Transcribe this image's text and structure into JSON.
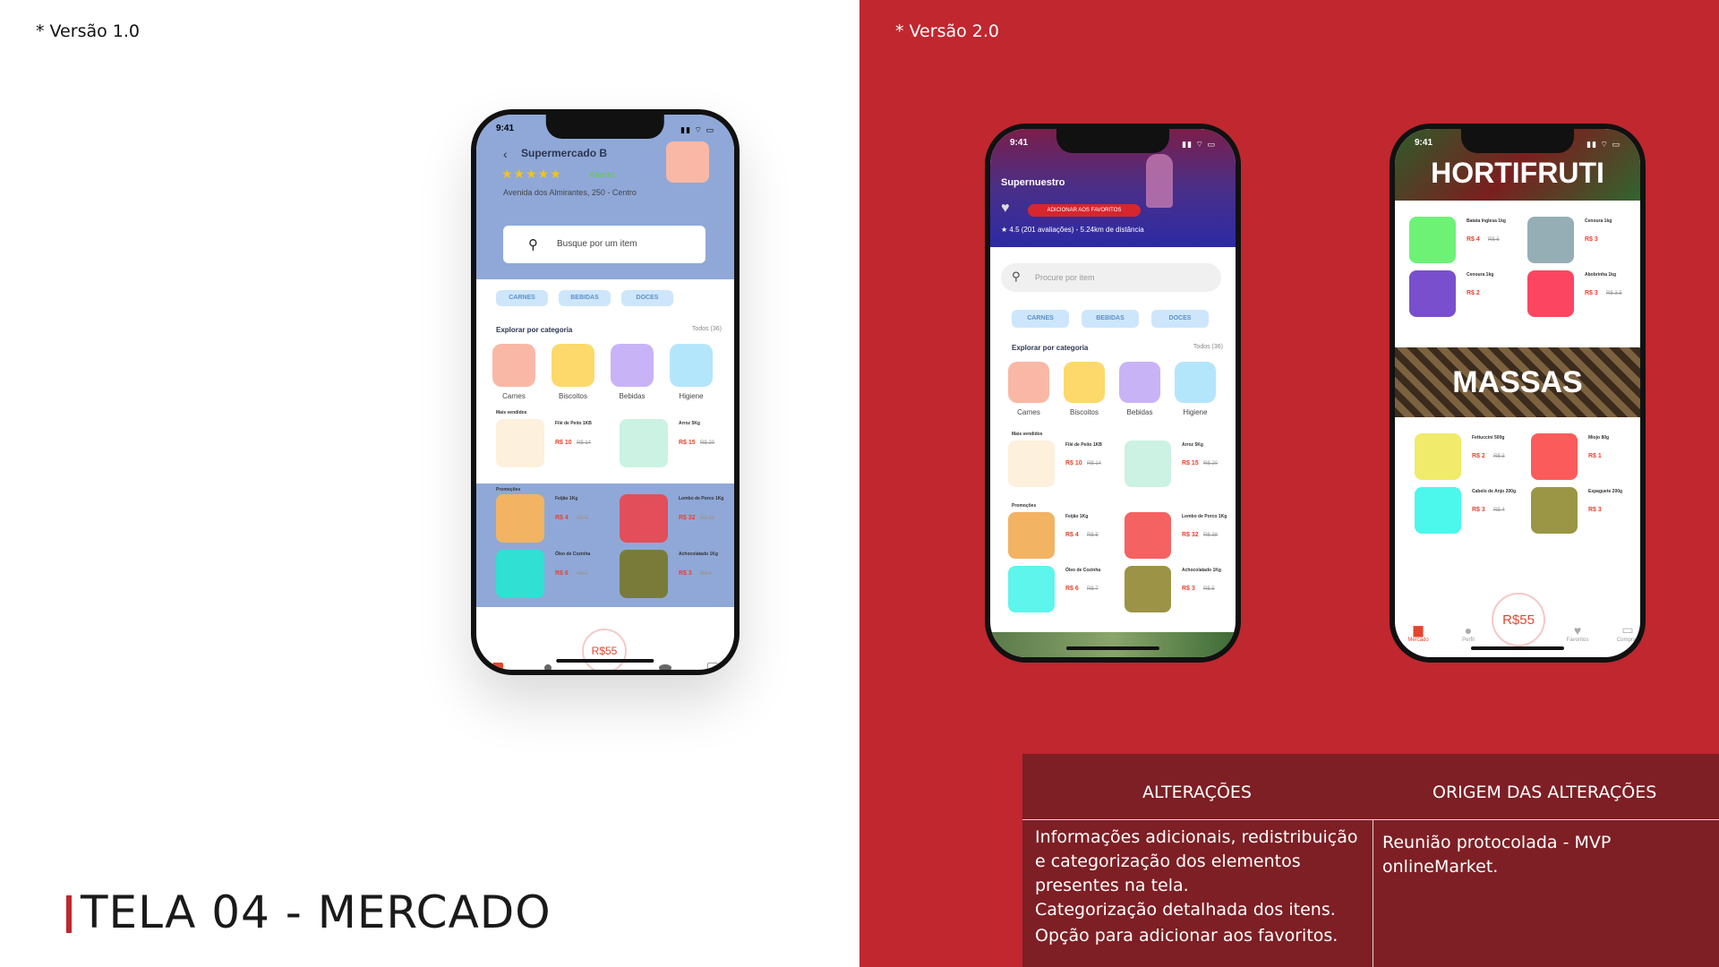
{
  "left": {
    "version_label": "* Versão 1.0",
    "slide_title": "TELA 04 - MERCADO"
  },
  "right": {
    "version_label": "* Versão 2.0"
  },
  "phone1": {
    "time": "9:41",
    "store_name": "Supermercado B",
    "rating_stars": "★★★★★",
    "open_status": "Aberto",
    "address": "Avenida dos Almirantes, 250 - Centro",
    "search_placeholder": "Busque por um item",
    "chips": [
      "CARNES",
      "BEBIDAS",
      "DOCES"
    ],
    "explore_title": "Explorar por categoria",
    "explore_all": "Todos (36)",
    "categories": [
      {
        "label": "Carnes",
        "color": "#f9b8a6"
      },
      {
        "label": "Biscoitos",
        "color": "#fcd96a"
      },
      {
        "label": "Bebidas",
        "color": "#c8b3f7"
      },
      {
        "label": "Higiene",
        "color": "#b4e6fb"
      }
    ],
    "best_sellers_title": "Mais vendidos",
    "best_sellers": [
      {
        "name": "Filé de Peito 1KB",
        "price": "R$ 10",
        "old": "R$ 14",
        "color": "#fdf0dc"
      },
      {
        "name": "Arroz 5Kg",
        "price": "R$ 15",
        "old": "R$ 20",
        "color": "#cbf2e2"
      }
    ],
    "promos_title": "Promoções",
    "promos": [
      {
        "name": "Feijão 1Kg",
        "price": "R$ 4",
        "old": "R$ 5",
        "color": "#f2b363"
      },
      {
        "name": "Lombo de Porco 1Kg",
        "price": "R$ 32",
        "old": "R$ 38",
        "color": "#e24e5a"
      },
      {
        "name": "Óleo de Cozinha",
        "price": "R$ 6",
        "old": "R$ 7",
        "color": "#2fe0d3"
      },
      {
        "name": "Achocolatado 1Kg",
        "price": "R$ 3",
        "old": "R$ 5",
        "color": "#787c38"
      }
    ],
    "cart_total": "R$55"
  },
  "phone2": {
    "time": "9:41",
    "store_name": "Supernuestro",
    "favorite_button": "ADICIONAR AOS FAVORITOS",
    "rating_text": "★ 4.5 (201 avaliações) - 5.24km de distância",
    "search_placeholder": "Procure por item",
    "chips": [
      "CARNES",
      "BEBIDAS",
      "DOCES"
    ],
    "explore_title": "Explorar por categoria",
    "explore_all": "Todos (36)",
    "categories": [
      {
        "label": "Carnes",
        "color": "#f9b8a6"
      },
      {
        "label": "Biscoitos",
        "color": "#fcd96a"
      },
      {
        "label": "Bebidas",
        "color": "#c8b3f7"
      },
      {
        "label": "Higiene",
        "color": "#b4e6fb"
      }
    ],
    "best_sellers_title": "Mais vendidos",
    "best_sellers": [
      {
        "name": "Filé de Peito 1KB",
        "price": "R$ 10",
        "old": "R$ 14",
        "color": "#fdf0dc"
      },
      {
        "name": "Arroz 5Kg",
        "price": "R$ 15",
        "old": "R$ 20",
        "color": "#cbf2e2"
      }
    ],
    "promos_title": "Promoções",
    "promos": [
      {
        "name": "Feijão 1Kg",
        "price": "R$ 4",
        "old": "R$ 5",
        "color": "#f2b363"
      },
      {
        "name": "Lombo de Porco 1Kg",
        "price": "R$ 32",
        "old": "R$ 38",
        "color": "#f56262"
      },
      {
        "name": "Óleo de Cozinha",
        "price": "R$ 6",
        "old": "R$ 7",
        "color": "#5ef5ec"
      },
      {
        "name": "Achocolatado 1Kg",
        "price": "R$ 3",
        "old": "R$ 5",
        "color": "#9c9346"
      }
    ]
  },
  "phone3": {
    "time": "9:41",
    "banner1": "HORTIFRUTI",
    "banner2": "MASSAS",
    "hortifruti": [
      {
        "name": "Batata Inglesa 1kg",
        "price": "R$ 4",
        "old": "R$ 5",
        "color": "#6df276"
      },
      {
        "name": "Cenoura 1kg",
        "price": "R$ 3",
        "old": "",
        "color": "#95aeb6"
      },
      {
        "name": "Cenoura 1kg",
        "price": "R$ 2",
        "old": "",
        "color": "#7a4fcd"
      },
      {
        "name": "Abobrinha 1kg",
        "price": "R$ 3",
        "old": "R$ 3,5",
        "color": "#fc4561"
      }
    ],
    "massas": [
      {
        "name": "Fettuccini 500g",
        "price": "R$ 2",
        "old": "R$ 3",
        "color": "#f0eb6a"
      },
      {
        "name": "Miojo 80g",
        "price": "R$ 1",
        "old": "",
        "color": "#fc5b5b"
      },
      {
        "name": "Cabelo de Anjo 200g",
        "price": "R$ 3",
        "old": "R$ 4",
        "color": "#4cf7ec"
      },
      {
        "name": "Espaguete 200g",
        "price": "R$ 3",
        "old": "",
        "color": "#9a9645"
      }
    ],
    "cart_total": "R$55",
    "tabs": [
      {
        "label": "Mercado",
        "icon": "store-icon"
      },
      {
        "label": "Perfil",
        "icon": "user-icon"
      },
      {
        "label": "Favoritos",
        "icon": "heart-icon"
      },
      {
        "label": "Compras",
        "icon": "wallet-icon"
      }
    ]
  },
  "changes_table": {
    "header_changes": "ALTERAÇÕES",
    "header_origin": "ORIGEM DAS ALTERAÇÕES",
    "changes_text": [
      "Informações adicionais, redistribuição e categorização dos elementos presentes na tela.",
      "Categorização detalhada dos itens.",
      "Opção para adicionar aos favoritos."
    ],
    "origin_text": "Reunião protocolada - MVP onlineMarket."
  },
  "colors": {
    "accent": "#c0272f",
    "table_bg": "#7d1f24"
  }
}
